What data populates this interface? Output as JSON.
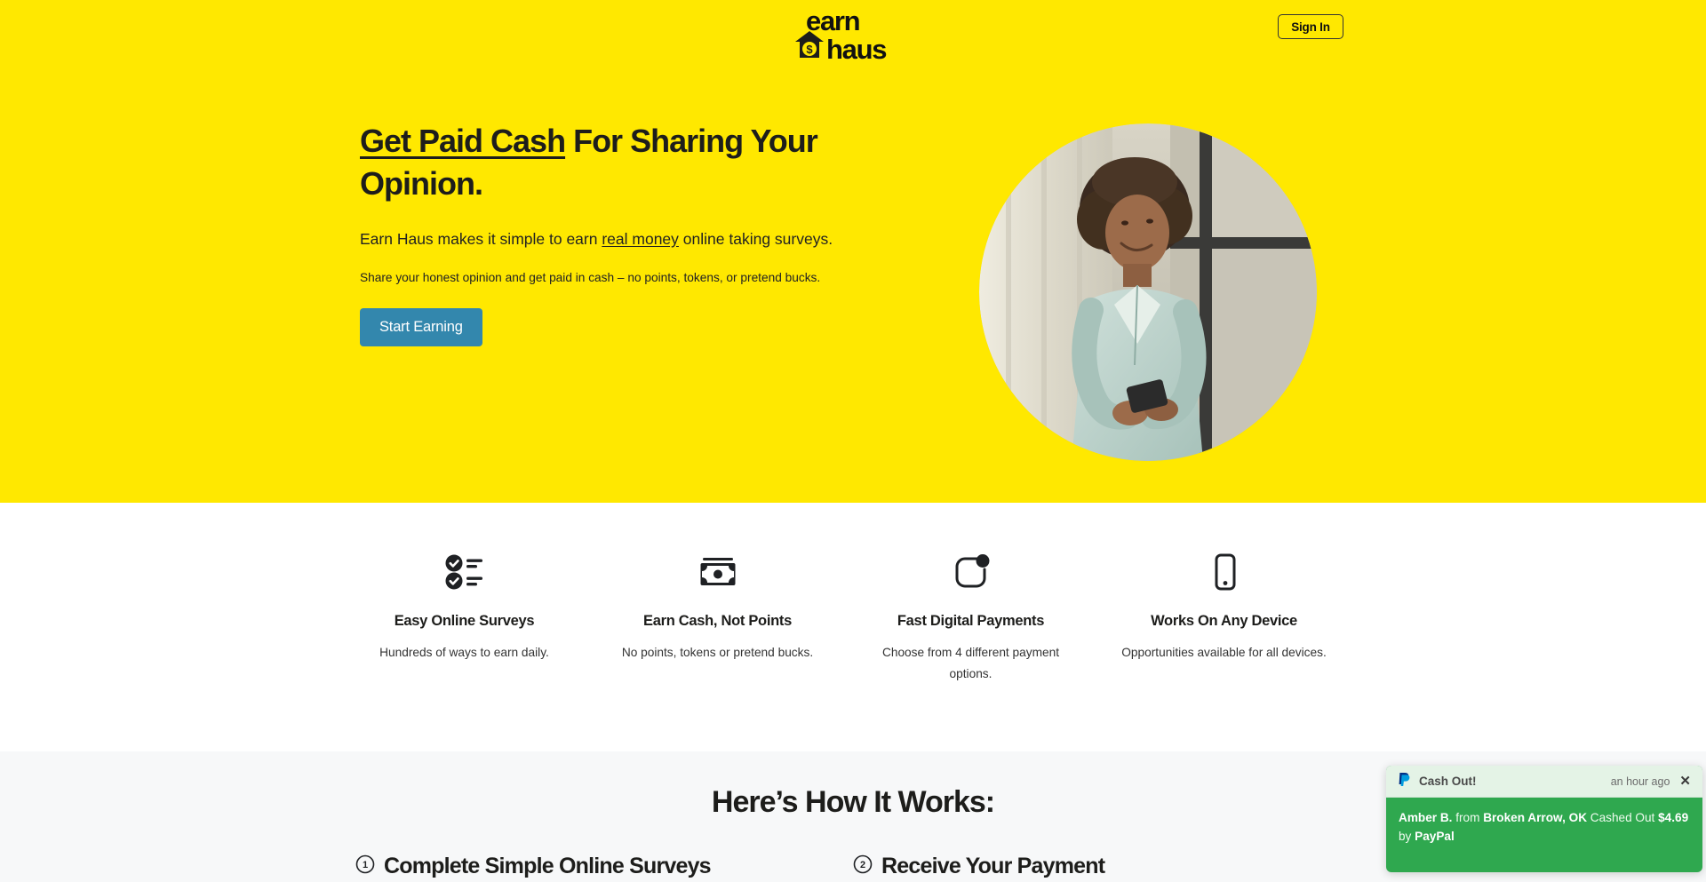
{
  "brand": {
    "name_top": "earn",
    "name_bottom": "haus",
    "house_symbol": "$",
    "yellow": "#ffe800",
    "accent_button": "#3387ad",
    "toast_green": "#2fa84f"
  },
  "nav": {
    "signin_label": "Sign In"
  },
  "hero": {
    "title_underlined": "Get Paid Cash",
    "title_rest": " For Sharing Your Opinion.",
    "sub_before": "Earn Haus makes it simple to earn ",
    "sub_underlined": "real money",
    "sub_after": " online taking surveys.",
    "note": "Share your honest opinion and get paid in cash – no points, tokens, or pretend bucks.",
    "cta_label": "Start Earning",
    "photo_alt": "Smiling woman holding a phone by a window"
  },
  "features": [
    {
      "icon": "checklist-icon",
      "title": "Easy Online Surveys",
      "desc": "Hundreds of ways to earn daily."
    },
    {
      "icon": "cash-bill-icon",
      "title": "Earn Cash, Not Points",
      "desc": "No points, tokens or pretend bucks."
    },
    {
      "icon": "notification-dot-icon",
      "title": "Fast Digital Payments",
      "desc": "Choose from 4 different payment options."
    },
    {
      "icon": "mobile-phone-icon",
      "title": "Works On Any Device",
      "desc": "Opportunities available for all devices."
    }
  ],
  "how_it_works": {
    "heading": "Here’s How It Works:",
    "steps": [
      {
        "number": "1",
        "label": "Complete Simple Online Surveys"
      },
      {
        "number": "2",
        "label": "Receive Your Payment"
      }
    ]
  },
  "toast": {
    "icon": "paypal-icon",
    "title": "Cash Out!",
    "time": "an hour ago",
    "close_label": "✕",
    "name": "Amber B.",
    "from_word": " from ",
    "location": "Broken Arrow, OK",
    "action_word": " Cashed Out ",
    "amount": "$4.69",
    "by_word": " by ",
    "method": "PayPal"
  }
}
